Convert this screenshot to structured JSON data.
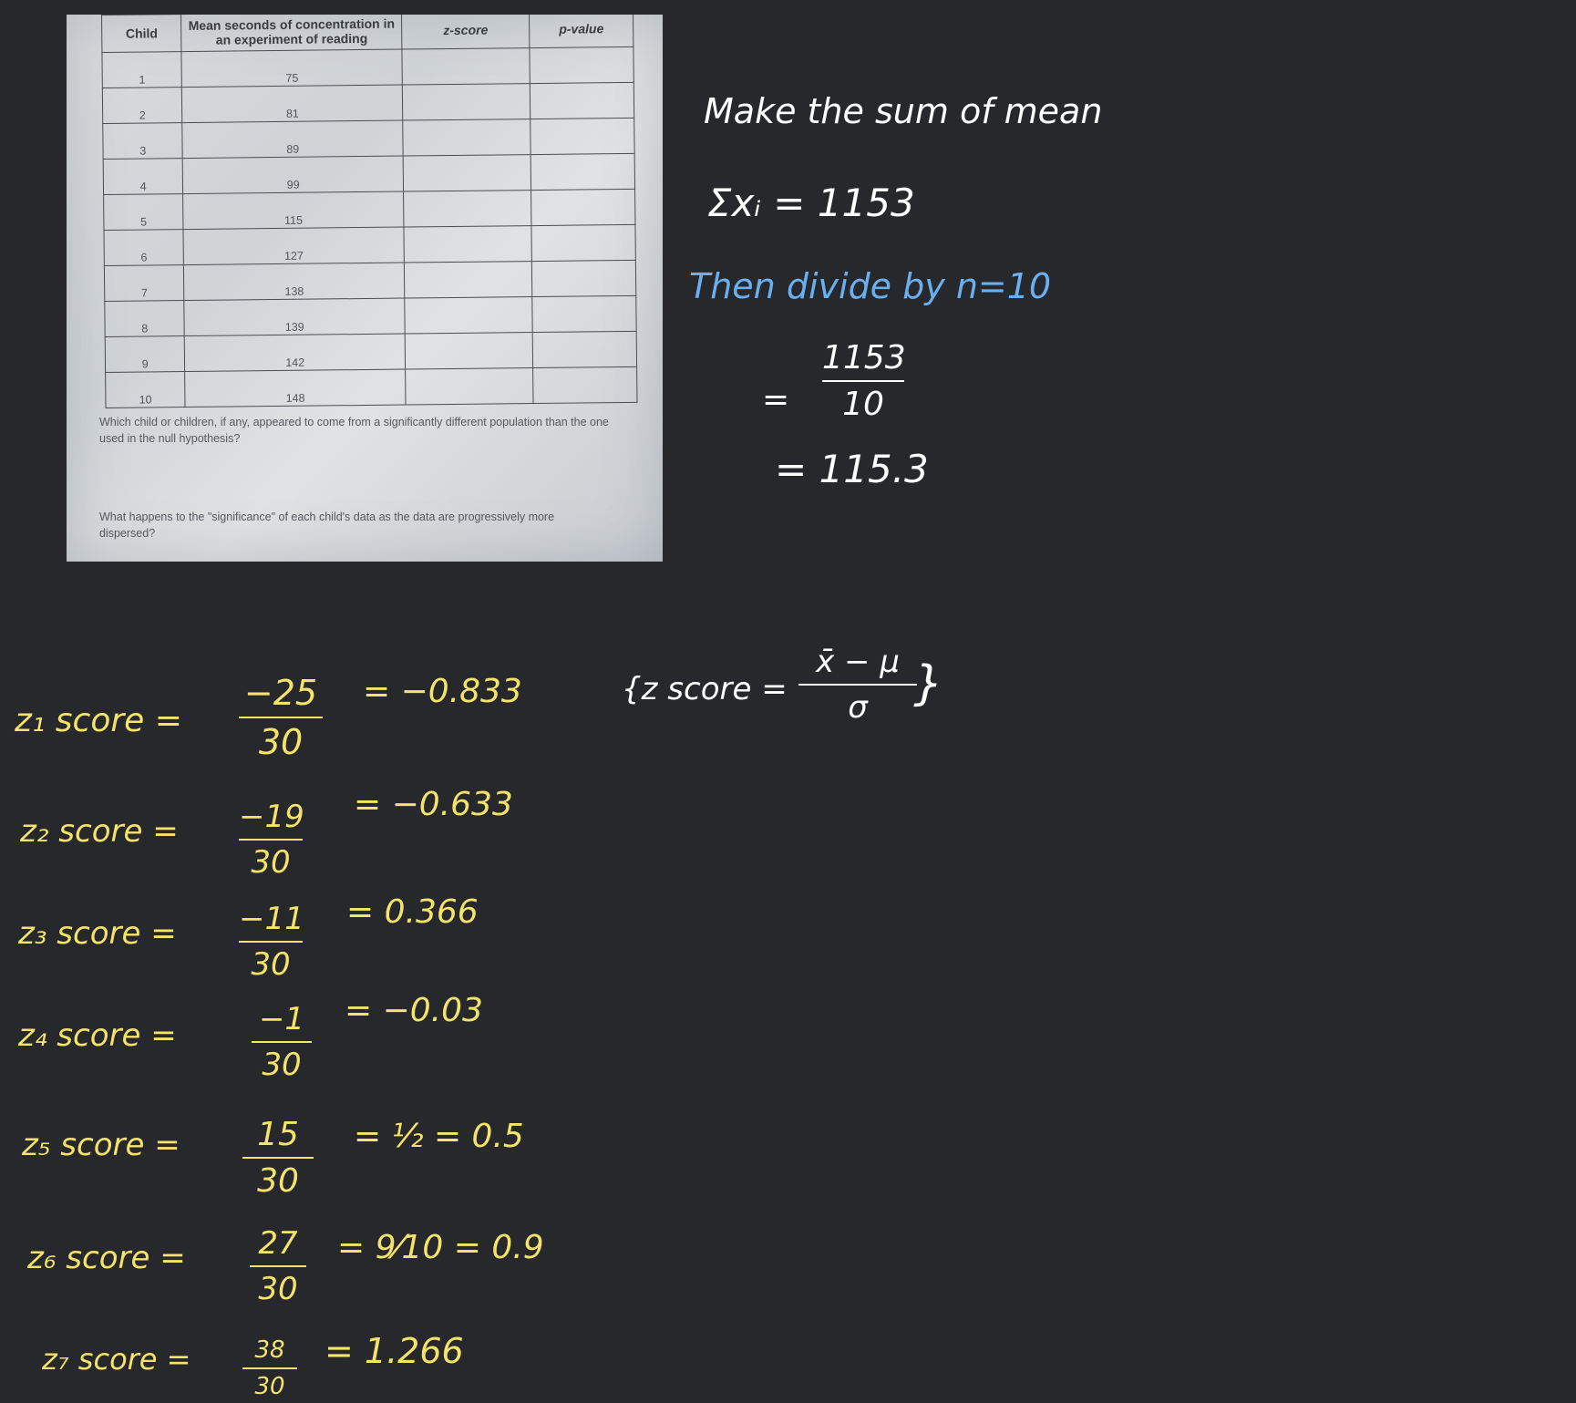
{
  "worksheet": {
    "headers": {
      "child": "Child",
      "mean": "Mean seconds of concentration in an experiment of reading",
      "z": "z-score",
      "p": "p-value"
    },
    "rows": [
      {
        "child": "1",
        "mean": "75"
      },
      {
        "child": "2",
        "mean": "81"
      },
      {
        "child": "3",
        "mean": "89"
      },
      {
        "child": "4",
        "mean": "99"
      },
      {
        "child": "5",
        "mean": "115"
      },
      {
        "child": "6",
        "mean": "127"
      },
      {
        "child": "7",
        "mean": "138"
      },
      {
        "child": "8",
        "mean": "139"
      },
      {
        "child": "9",
        "mean": "142"
      },
      {
        "child": "10",
        "mean": "148"
      }
    ],
    "question1": "Which child or children, if any, appeared to come from a significantly different population than the one used in the null hypothesis?",
    "question2": "What happens to the \"significance\" of each child's data as the data are progressively more dispersed?"
  },
  "notes": {
    "line1": "Make the sum of mean",
    "sum": "Σxᵢ = 1153",
    "divide": "Then divide by n=10",
    "eq_sign": "=",
    "frac_num": "1153",
    "frac_den": "10",
    "result": "= 115.3",
    "formula_label": "{z score =",
    "formula_num": "x̄ − μ",
    "formula_den": "σ",
    "formula_close": "}"
  },
  "zscores": [
    {
      "label": "z₁ score =",
      "num": "−25",
      "den": "30",
      "result": "= −0.833"
    },
    {
      "label": "z₂ score =",
      "num": "−19",
      "den": "30",
      "result": "= −0.633"
    },
    {
      "label": "z₃ score =",
      "num": "−11",
      "den": "30",
      "result": "= 0.366"
    },
    {
      "label": "z₄ score =",
      "num": "−1",
      "den": "30",
      "result": "= −0.03"
    },
    {
      "label": "z₅ score =",
      "num": "15",
      "den": "30",
      "result": "= ½ = 0.5"
    },
    {
      "label": "z₆ score =",
      "num": "27",
      "den": "30",
      "result": "= 9⁄10 = 0.9"
    },
    {
      "label": "z₇ score =",
      "num": "38",
      "den": "30",
      "result": "= 1.266"
    }
  ]
}
